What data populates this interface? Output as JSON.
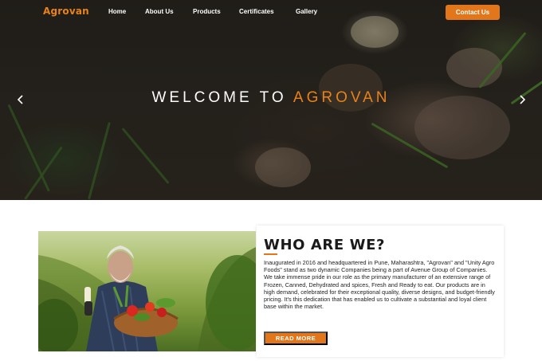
{
  "nav": {
    "logo": "Agrovan",
    "items": [
      {
        "label": "Home"
      },
      {
        "label": "About Us"
      },
      {
        "label": "Products"
      },
      {
        "label": "Certificates"
      },
      {
        "label": "Gallery"
      }
    ],
    "contact_label": "Contact Us"
  },
  "hero": {
    "title_prefix": "WELCOME TO ",
    "title_accent": "AGROVAN",
    "prev_icon": "chevron-left-icon",
    "next_icon": "chevron-right-icon"
  },
  "about": {
    "title": "WHO ARE WE?",
    "body": "Inaugurated in 2016 and headquartered in Pune, Maharashtra, \"Agrovan\" and \"Unity Agro Foods\" stand as two dynamic Companies being a part of Avenue Group of Companies. We take immense pride in our role as the primary manufacturer of an extensive range of Frozen, Canned, Dehydrated and spices, Fresh and Ready to eat. Our products are in high demand, celebrated for their exceptional quality, diverse designs, and budget-friendly pricing. It's this dedication that has enabled us to cultivate a substantial and loyal client base within the market.",
    "button_label": "READ MORE"
  },
  "colors": {
    "accent": "#e2761a",
    "hero_dark": "#2b2721"
  }
}
